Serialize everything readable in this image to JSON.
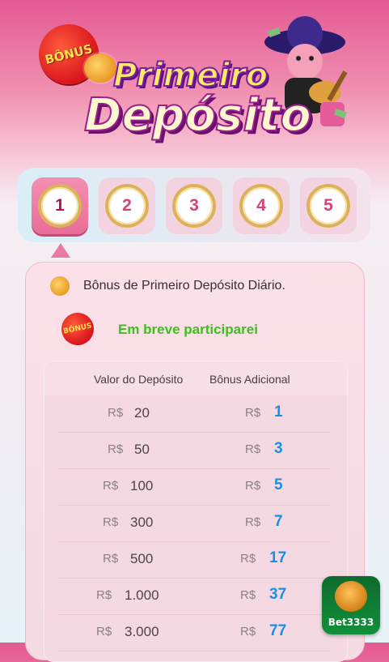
{
  "banner": {
    "badge": "BÔNUS",
    "title_line1": "Primeiro",
    "title_line2": "Depósito"
  },
  "steps": [
    {
      "label": "1",
      "active": true
    },
    {
      "label": "2",
      "active": false
    },
    {
      "label": "3",
      "active": false
    },
    {
      "label": "4",
      "active": false
    },
    {
      "label": "5",
      "active": false
    }
  ],
  "card": {
    "daily_text": "Bônus de Primeiro Depósito Diário.",
    "bonus_badge": "BÔNUS",
    "status_text": "Em breve participarei"
  },
  "table": {
    "col_deposit": "Valor do Depósito",
    "col_bonus": "Bônus Adicional",
    "currency": "R$",
    "rows": [
      {
        "deposit": "20",
        "bonus": "1"
      },
      {
        "deposit": "50",
        "bonus": "3"
      },
      {
        "deposit": "100",
        "bonus": "5"
      },
      {
        "deposit": "300",
        "bonus": "7"
      },
      {
        "deposit": "500",
        "bonus": "17"
      },
      {
        "deposit": "1.000",
        "bonus": "37"
      },
      {
        "deposit": "3.000",
        "bonus": "77"
      }
    ]
  },
  "app_icon": {
    "label": "Bet3333"
  },
  "colors": {
    "bonus_value": "#1d8de0",
    "status_green": "#3cc11a",
    "active_step": "#e96d98"
  }
}
